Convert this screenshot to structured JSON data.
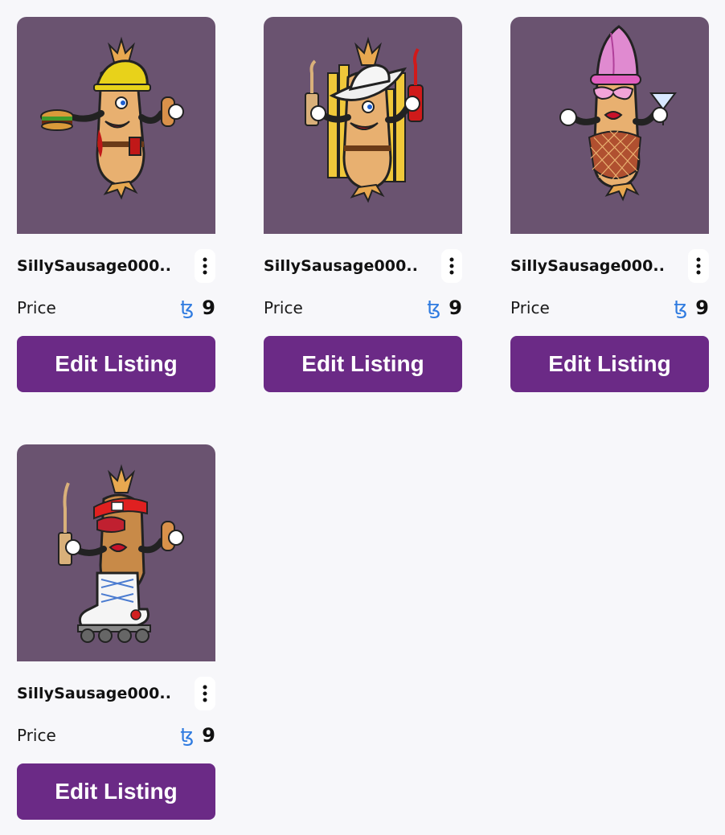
{
  "colors": {
    "page_bg": "#f7f7fa",
    "thumb_bg": "#6a5370",
    "button_bg": "#6b2a86",
    "tez_blue": "#2f7be0"
  },
  "cards": [
    {
      "name": "SillySausage000..",
      "price_label": "Price",
      "currency_icon": "tezos-icon",
      "currency_symbol": "ꜩ",
      "price": "9",
      "button_label": "Edit Listing",
      "art": "sausage-hardhat-burger"
    },
    {
      "name": "SillySausage000..",
      "price_label": "Price",
      "currency_icon": "tezos-icon",
      "currency_symbol": "ꜩ",
      "price": "9",
      "button_label": "Edit Listing",
      "art": "sausage-cowboy-fries"
    },
    {
      "name": "SillySausage000..",
      "price_label": "Price",
      "currency_icon": "tezos-icon",
      "currency_symbol": "ꜩ",
      "price": "9",
      "button_label": "Edit Listing",
      "art": "sausage-pink-fishnet"
    },
    {
      "name": "SillySausage000..",
      "price_label": "Price",
      "currency_icon": "tezos-icon",
      "currency_symbol": "ꜩ",
      "price": "9",
      "button_label": "Edit Listing",
      "art": "sausage-rollerskate"
    }
  ]
}
